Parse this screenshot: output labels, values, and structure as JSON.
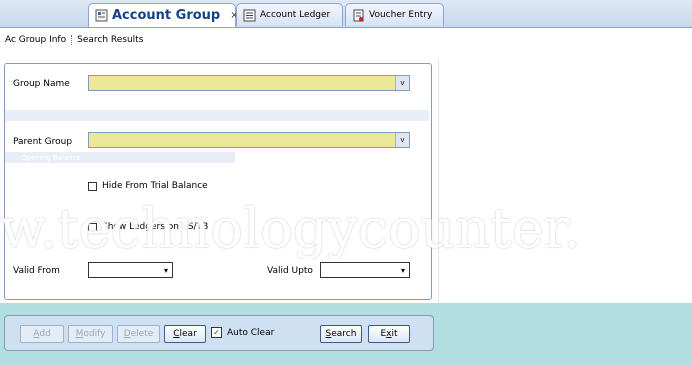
{
  "tabs": [
    {
      "label": "Account Group",
      "icon": "account-group-icon",
      "active": true,
      "closable": true,
      "close_glyph": "×"
    },
    {
      "label": "Account Ledger",
      "icon": "account-ledger-icon",
      "active": false
    },
    {
      "label": "Voucher Entry",
      "icon": "voucher-entry-icon",
      "active": false
    }
  ],
  "subtabs": [
    "Ac Group Info",
    "Search Results"
  ],
  "form": {
    "group_name_label": "Group Name",
    "group_name_value": "",
    "parent_group_label": "Parent Group",
    "parent_group_value": "",
    "opening_balance_label": "Opening Balance",
    "hide_trial_label": "Hide From Trial Balance",
    "hide_trial_checked": false,
    "show_ledgers_label": "Show Ledgers on BS/TB",
    "show_ledgers_checked": false,
    "valid_from_label": "Valid From",
    "valid_from_value": "",
    "valid_upto_label": "Valid Upto",
    "valid_upto_value": "",
    "dropdown_glyph": "v",
    "date_dropdown_glyph": "▾"
  },
  "buttons": {
    "add": {
      "accel": "A",
      "rest": "dd"
    },
    "modify": {
      "accel": "M",
      "rest": "odify"
    },
    "delete": {
      "accel": "D",
      "rest": "elete"
    },
    "clear": {
      "accel": "C",
      "rest": "lear"
    },
    "auto_clear_label": "Auto Clear",
    "auto_clear_checked": true,
    "check_glyph": "✓",
    "search": {
      "accel": "S",
      "rest": "earch"
    },
    "exit": {
      "pre": "E",
      "accel": "x",
      "rest": "it"
    }
  },
  "watermark": "w.technologycounter.",
  "colors": {
    "accent": "#15428b",
    "combo_fill": "#ece89a",
    "bottom_band": "#b1dfe1",
    "button_panel": "#cfe0f2"
  }
}
